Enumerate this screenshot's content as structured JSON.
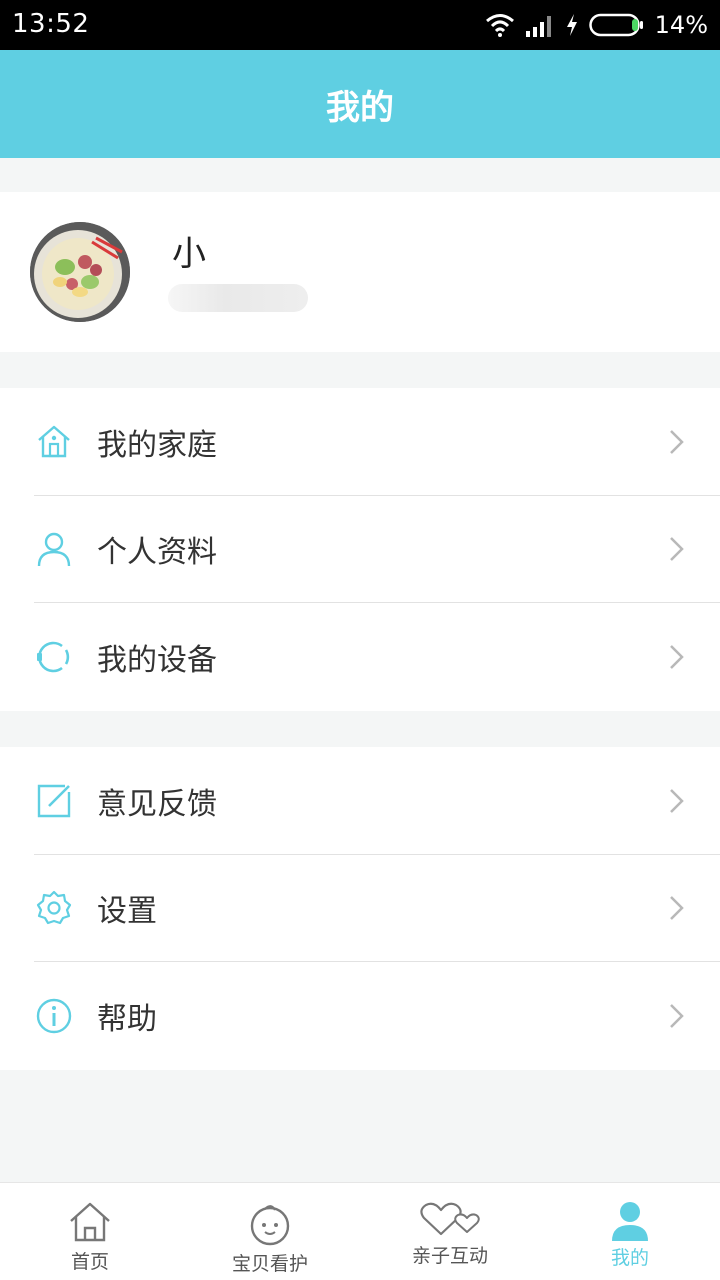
{
  "status_bar": {
    "time": "13:52",
    "battery_text": "14%",
    "icons": [
      "wifi-icon",
      "signal-icon",
      "charging-icon",
      "battery-icon"
    ]
  },
  "header": {
    "title": "我的"
  },
  "profile": {
    "name": "小"
  },
  "menu_groups": [
    {
      "items": [
        {
          "label": "我的家庭",
          "icon": "home-icon"
        },
        {
          "label": "个人资料",
          "icon": "person-icon"
        },
        {
          "label": "我的设备",
          "icon": "watch-device-icon"
        }
      ]
    },
    {
      "items": [
        {
          "label": "意见反馈",
          "icon": "feedback-edit-icon"
        },
        {
          "label": "设置",
          "icon": "gear-icon"
        },
        {
          "label": "帮助",
          "icon": "info-icon"
        }
      ]
    }
  ],
  "tabs": [
    {
      "label": "首页",
      "icon": "house-outline-icon",
      "active": false
    },
    {
      "label": "宝贝看护",
      "icon": "baby-face-icon",
      "active": false
    },
    {
      "label": "亲子互动",
      "icon": "hearts-icon",
      "active": false
    },
    {
      "label": "我的",
      "icon": "person-filled-icon",
      "active": true
    }
  ],
  "colors": {
    "accent": "#5fcfe2",
    "background": "#f4f6f6",
    "text": "#333333"
  }
}
